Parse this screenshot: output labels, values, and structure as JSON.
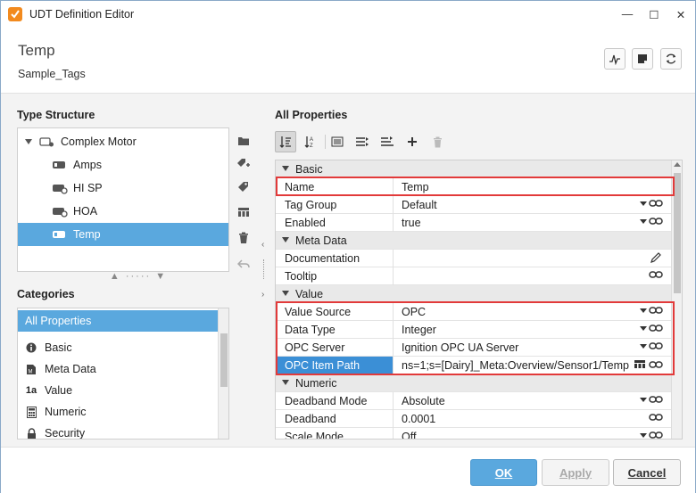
{
  "window": {
    "title": "UDT Definition Editor",
    "minimize_glyph": "—",
    "maximize_glyph": "☐",
    "close_glyph": "✕",
    "app_icon": "ignition-logo-icon"
  },
  "header": {
    "title": "Temp",
    "subtitle": "Sample_Tags",
    "buttons": [
      "history-icon",
      "note-icon",
      "refresh-icon"
    ]
  },
  "type_structure": {
    "label": "Type Structure",
    "items": [
      {
        "label": "Complex Motor",
        "icon": "udt-definition-icon",
        "expanded": true
      },
      {
        "label": "Amps",
        "icon": "memory-tag-icon"
      },
      {
        "label": "HI SP",
        "icon": "opc-tag-icon"
      },
      {
        "label": "HOA",
        "icon": "opc-tag-icon"
      },
      {
        "label": "Temp",
        "icon": "memory-tag-icon",
        "selected": true
      }
    ],
    "resizer_glyph": "▲ ····· ▼"
  },
  "side_tools": [
    "folder-icon",
    "add-tag-icon",
    "tag-icon",
    "udt-instance-icon",
    "delete-icon",
    "undo-icon"
  ],
  "categories": {
    "label": "Categories",
    "items": [
      {
        "label": "All Properties",
        "icon": "",
        "selected": true
      },
      {
        "label": "Basic",
        "icon": "info-icon"
      },
      {
        "label": "Meta Data",
        "icon": "metadata-icon"
      },
      {
        "label": "Value",
        "icon": "value-icon",
        "icon_text": "1a"
      },
      {
        "label": "Numeric",
        "icon": "calculator-icon"
      },
      {
        "label": "Security",
        "icon": "lock-icon"
      }
    ]
  },
  "all_properties": {
    "label": "All Properties",
    "toolbar": [
      "sort-category-icon",
      "sort-alpha-icon",
      "list-view-icon",
      "expand-all-icon",
      "collapse-all-icon",
      "add-icon",
      "trash-icon"
    ],
    "rows": [
      {
        "type": "category",
        "name": "Basic"
      },
      {
        "type": "prop",
        "name": "Name",
        "value": "Temp",
        "control": ""
      },
      {
        "type": "prop",
        "name": "Tag Group",
        "value": "Default",
        "control": "dropdown-binding"
      },
      {
        "type": "prop",
        "name": "Enabled",
        "value": "true",
        "control": "dropdown-binding"
      },
      {
        "type": "category",
        "name": "Meta Data"
      },
      {
        "type": "prop",
        "name": "Documentation",
        "value": "",
        "control": "edit"
      },
      {
        "type": "prop",
        "name": "Tooltip",
        "value": "",
        "control": "binding"
      },
      {
        "type": "category",
        "name": "Value"
      },
      {
        "type": "prop",
        "name": "Value Source",
        "value": "OPC",
        "control": "dropdown-binding"
      },
      {
        "type": "prop",
        "name": "Data Type",
        "value": "Integer",
        "control": "dropdown-binding"
      },
      {
        "type": "prop",
        "name": "OPC Server",
        "value": "Ignition OPC UA Server",
        "control": "dropdown-binding"
      },
      {
        "type": "prop",
        "name": "OPC Item Path",
        "value": "ns=1;s=[Dairy]_Meta:Overview/Sensor1/Temp",
        "control": "browse-binding",
        "selected": true
      },
      {
        "type": "category",
        "name": "Numeric"
      },
      {
        "type": "prop",
        "name": "Deadband Mode",
        "value": "Absolute",
        "control": "dropdown-binding"
      },
      {
        "type": "prop",
        "name": "Deadband",
        "value": "0.0001",
        "control": "binding"
      },
      {
        "type": "prop",
        "name": "Scale Mode",
        "value": "Off",
        "control": "dropdown-binding"
      }
    ]
  },
  "footer": {
    "ok_label": "OK",
    "apply_label": "Apply",
    "cancel_label": "Cancel"
  },
  "colors": {
    "selection": "#5aa8de",
    "highlight": "#e23a3a",
    "prop_selected": "#3b8fd6"
  }
}
